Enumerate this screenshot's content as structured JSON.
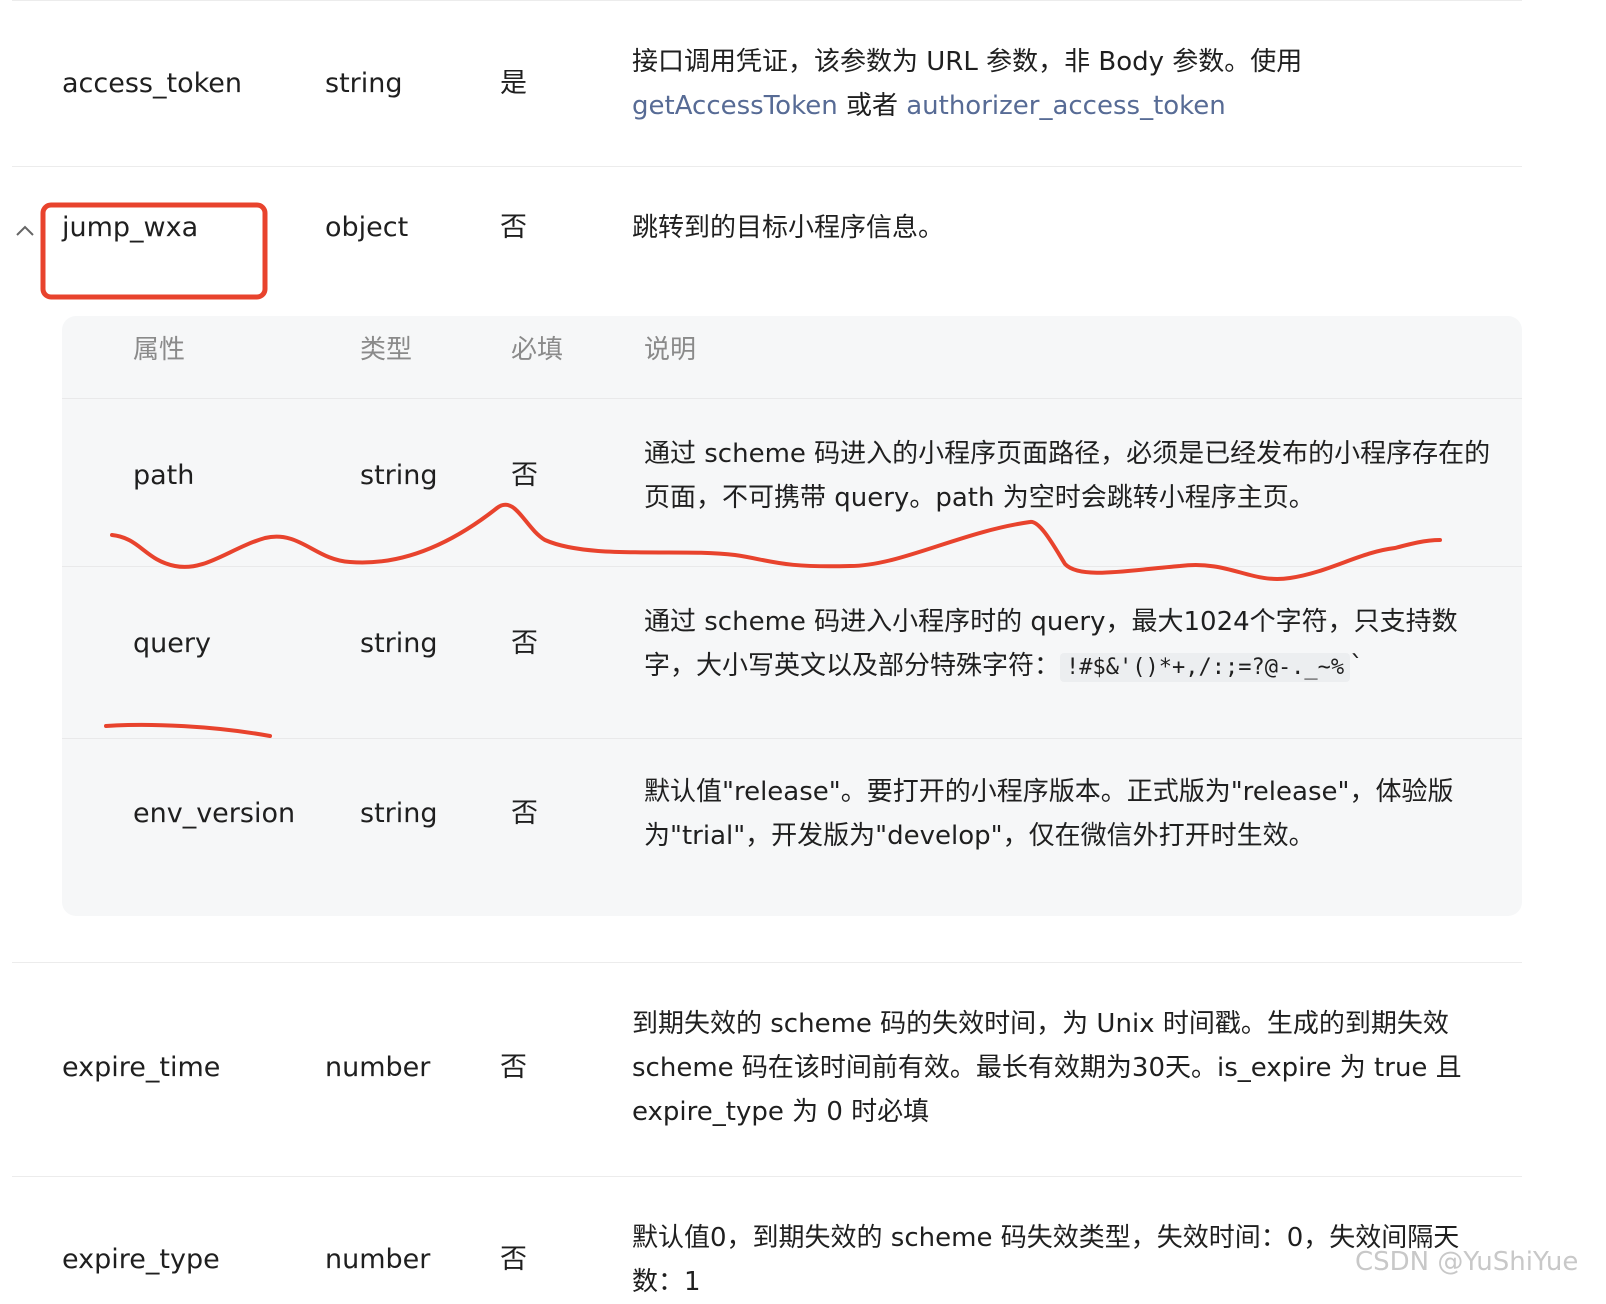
{
  "rows": [
    {
      "name": "access_token",
      "type": "string",
      "required": "是",
      "desc_prefix": "接口调用凭证，该参数为 URL 参数，非 Body 参数。使用",
      "link1": "getAccessToken",
      "mid": " 或者 ",
      "link2": "authorizer_access_token"
    },
    {
      "name": "jump_wxa",
      "type": "object",
      "required": "否",
      "desc": "跳转到的目标小程序信息。"
    },
    {
      "name": "expire_time",
      "type": "number",
      "required": "否",
      "desc": "到期失效的 scheme 码的失效时间，为 Unix 时间戳。生成的到期失效 scheme 码在该时间前有效。最长有效期为30天。is_expire 为 true 且 expire_type 为 0 时必填"
    },
    {
      "name": "expire_type",
      "type": "number",
      "required": "否",
      "desc": "默认值0，到期失效的 scheme 码失效类型，失效时间：0，失效间隔天数：1"
    }
  ],
  "sub": {
    "headers": [
      "属性",
      "类型",
      "必填",
      "说明"
    ],
    "rows": [
      {
        "name": "path",
        "type": "string",
        "required": "否",
        "desc": "通过 scheme 码进入的小程序页面路径，必须是已经发布的小程序存在的页面，不可携带 query。path 为空时会跳转小程序主页。"
      },
      {
        "name": "query",
        "type": "string",
        "required": "否",
        "desc": "通过 scheme 码进入小程序时的 query，最大1024个字符，只支持数字，大小写英文以及部分特殊字符：",
        "code": "!#$&'()*+,/:;=?@-._~%",
        "code_tail": "`"
      },
      {
        "name": "env_version",
        "type": "string",
        "required": "否",
        "desc": "默认值\"release\"。要打开的小程序版本。正式版为\"release\"，体验版为\"trial\"，开发版为\"develop\"，仅在微信外打开时生效。"
      }
    ]
  },
  "collapse_icon": "chevron-up-icon",
  "annotation_color": "#e8432d",
  "watermark": "CSDN @YuShiYue"
}
